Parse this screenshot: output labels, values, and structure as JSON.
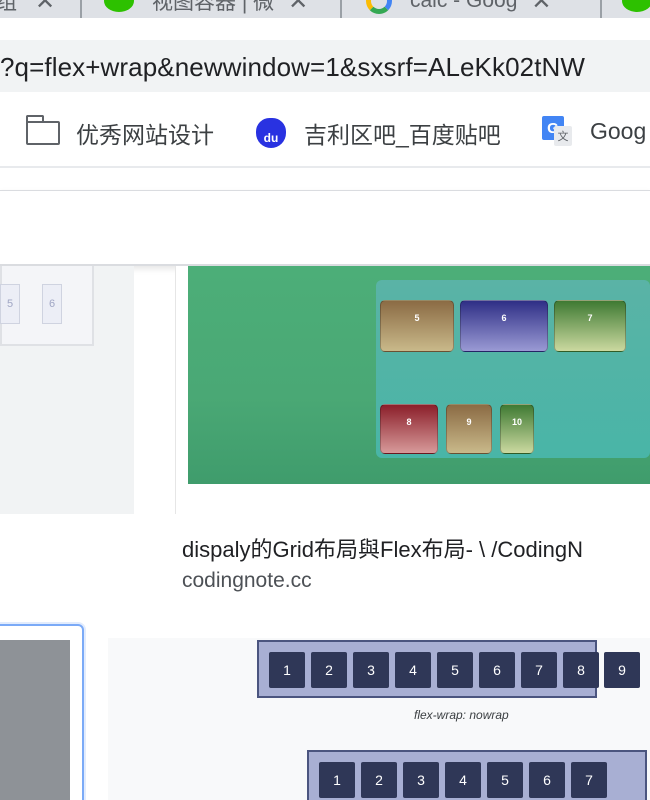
{
  "tabs": [
    {
      "label": "组",
      "close": "✕"
    },
    {
      "label": "视图容器 | 微",
      "close": "✕"
    },
    {
      "label": "calc - Goog",
      "close": "✕"
    }
  ],
  "address_bar": {
    "url": "?q=flex+wrap&newwindow=1&sxsrf=ALeKk02tNW"
  },
  "bookmarks": [
    {
      "label": "优秀网站设计",
      "icon": "folder-icon"
    },
    {
      "label": "吉利区吧_百度贴吧",
      "icon": "baidu-icon",
      "glyph": "du"
    },
    {
      "label": "Goog",
      "icon": "google-translate-icon",
      "glyph_g": "G",
      "glyph_w": "文"
    }
  ],
  "thumbnail_left": {
    "boxes": [
      "5",
      "6"
    ]
  },
  "thumbnail_grid": {
    "boxes": [
      "5",
      "6",
      "7",
      "8",
      "9",
      "10"
    ]
  },
  "result": {
    "title": "dispaly的Grid布局與Flex布局- \\ /CodingN",
    "site": "codingnote.cc"
  },
  "thumbnail_flex": {
    "row1": [
      "1",
      "2",
      "3",
      "4",
      "5",
      "6",
      "7",
      "8",
      "9"
    ],
    "caption": "flex-wrap: nowrap",
    "row2": [
      "1",
      "2",
      "3",
      "4",
      "5",
      "6",
      "7"
    ]
  },
  "colors": {
    "accent_blue": "#7baaf7",
    "grid_green": "#4cae78",
    "flex_item": "#2f3757"
  }
}
